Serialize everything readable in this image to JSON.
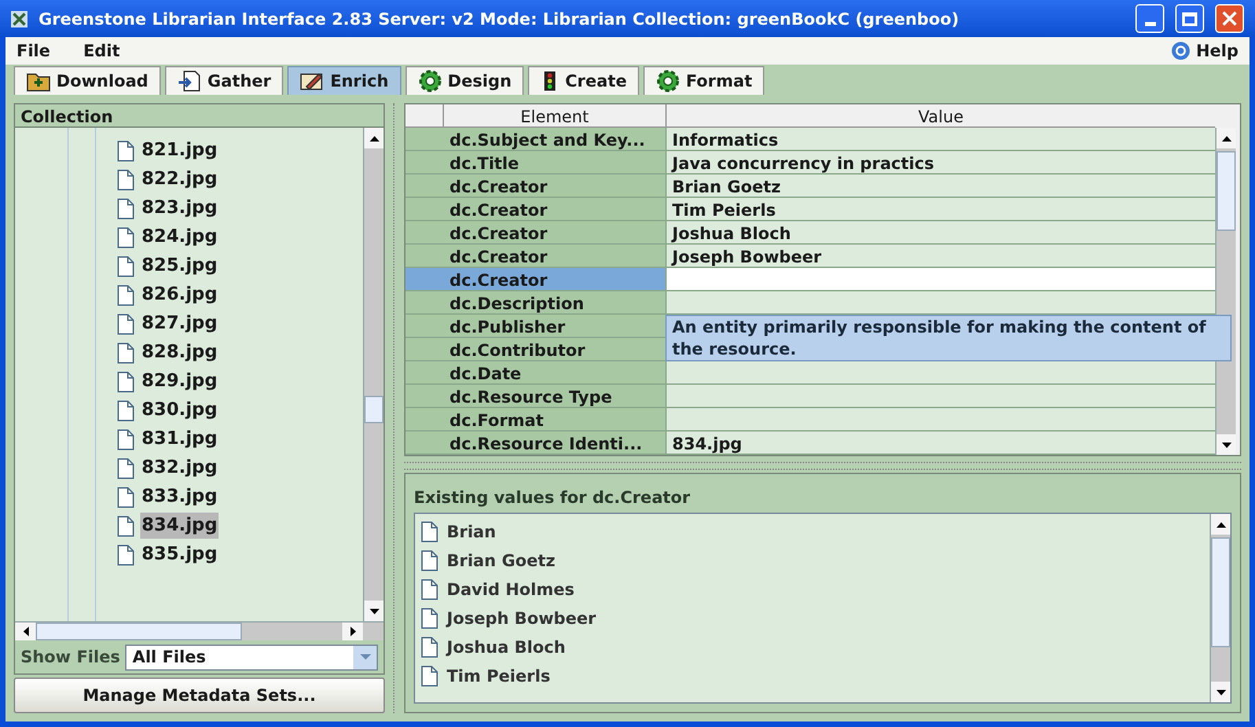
{
  "window": {
    "title": "Greenstone Librarian Interface 2.83  Server: v2  Mode: Librarian  Collection: greenBookC (greenboo)"
  },
  "menu": [
    "File",
    "Edit"
  ],
  "help": "Help",
  "tabs": [
    {
      "label": "Download",
      "selected": false,
      "kind": "download"
    },
    {
      "label": "Gather",
      "selected": false,
      "kind": "gather"
    },
    {
      "label": "Enrich",
      "selected": true,
      "kind": "enrich"
    },
    {
      "label": "Design",
      "selected": false,
      "kind": "gear"
    },
    {
      "label": "Create",
      "selected": false,
      "kind": "create"
    },
    {
      "label": "Format",
      "selected": false,
      "kind": "gear"
    }
  ],
  "collection": {
    "title": "Collection",
    "files": [
      {
        "name": "821.jpg",
        "selected": false
      },
      {
        "name": "822.jpg",
        "selected": false
      },
      {
        "name": "823.jpg",
        "selected": false
      },
      {
        "name": "824.jpg",
        "selected": false
      },
      {
        "name": "825.jpg",
        "selected": false
      },
      {
        "name": "826.jpg",
        "selected": false
      },
      {
        "name": "827.jpg",
        "selected": false
      },
      {
        "name": "828.jpg",
        "selected": false
      },
      {
        "name": "829.jpg",
        "selected": false
      },
      {
        "name": "830.jpg",
        "selected": false
      },
      {
        "name": "831.jpg",
        "selected": false
      },
      {
        "name": "832.jpg",
        "selected": false
      },
      {
        "name": "833.jpg",
        "selected": false
      },
      {
        "name": "834.jpg",
        "selected": true
      },
      {
        "name": "835.jpg",
        "selected": false
      }
    ],
    "show_files_label": "Show Files",
    "show_files_value": "All Files",
    "manage_button": "Manage Metadata Sets..."
  },
  "metadata": {
    "columns": [
      "Element",
      "Value"
    ],
    "rows": [
      {
        "element": "dc.Subject and Key...",
        "value": "Informatics",
        "selected": false
      },
      {
        "element": "dc.Title",
        "value": "Java concurrency in practics",
        "selected": false
      },
      {
        "element": "dc.Creator",
        "value": "Brian Goetz",
        "selected": false
      },
      {
        "element": "dc.Creator",
        "value": "Tim Peierls",
        "selected": false
      },
      {
        "element": "dc.Creator",
        "value": "Joshua Bloch",
        "selected": false
      },
      {
        "element": "dc.Creator",
        "value": "Joseph Bowbeer",
        "selected": false
      },
      {
        "element": "dc.Creator",
        "value": "",
        "selected": true
      },
      {
        "element": "dc.Description",
        "value": "",
        "selected": false
      },
      {
        "element": "dc.Publisher",
        "value": "",
        "selected": false
      },
      {
        "element": "dc.Contributor",
        "value": "",
        "selected": false
      },
      {
        "element": "dc.Date",
        "value": "",
        "selected": false
      },
      {
        "element": "dc.Resource Type",
        "value": "",
        "selected": false
      },
      {
        "element": "dc.Format",
        "value": "",
        "selected": false
      },
      {
        "element": "dc.Resource Identi...",
        "value": "834.jpg",
        "selected": false
      }
    ],
    "tooltip": "An entity primarily responsible for making the content of the resource."
  },
  "existing": {
    "title": "Existing values for dc.Creator",
    "values": [
      "Brian",
      "Brian Goetz",
      "David Holmes",
      "Joseph Bowbeer",
      "Joshua Bloch",
      "Tim Peierls"
    ]
  }
}
